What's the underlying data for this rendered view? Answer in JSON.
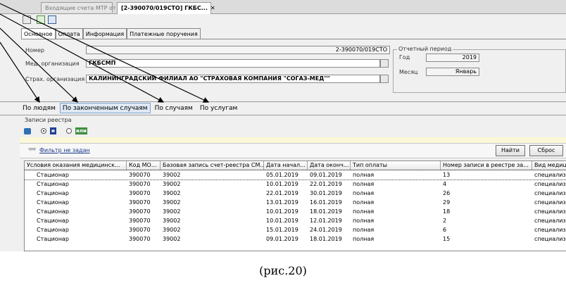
{
  "doc_tabs": {
    "inactive": "Входящие счета МТР от М...",
    "active": "[2-390070/019СТО] ГКБС...",
    "close": "✕"
  },
  "form_tabs": [
    "Основное",
    "Оплата",
    "Информация",
    "Платежные поручения"
  ],
  "form": {
    "number_label": "Номер",
    "number_value": "2-390070/019СТО",
    "medorg_label": "Мед. организация",
    "medorg_value": "ГКБСМП",
    "insorg_label": "Страх. организация",
    "insorg_value": "КАЛИНИНГРАДСКИЙ ФИЛИАЛ АО \"СТРАХОВАЯ КОМПАНИЯ \"СОГАЗ-МЕД\"\""
  },
  "period": {
    "title": "Отчетный период",
    "year_label": "Год",
    "year_value": "2019",
    "month_label": "Месяц",
    "month_value": "Январь"
  },
  "view_tabs": [
    "По людям",
    "По законченным случаям",
    "По случаям",
    "По услугам"
  ],
  "registry": {
    "title": "Записи реестра",
    "and_label": "и",
    "or_label": "или"
  },
  "filter": {
    "text": "Фильтр не задан",
    "find": "Найти",
    "reset": "Сброс"
  },
  "table": {
    "columns": [
      "Условия оказания медицинск...",
      "Код МО...",
      "Базовая запись счет-реестра СМ...",
      "Дата начал...",
      "Дата оконч...",
      "Тип оплаты",
      "Номер записи в реестре за...",
      "Вид медиц..."
    ],
    "rows": [
      [
        "Стационар",
        "390070",
        "39002",
        "05.01.2019",
        "09.01.2019",
        "полная",
        "13",
        "специализ..."
      ],
      [
        "Стационар",
        "390070",
        "39002",
        "10.01.2019",
        "22.01.2019",
        "полная",
        "4",
        "специализ..."
      ],
      [
        "Стационар",
        "390070",
        "39002",
        "22.01.2019",
        "30.01.2019",
        "полная",
        "26",
        "специализ..."
      ],
      [
        "Стационар",
        "390070",
        "39002",
        "13.01.2019",
        "16.01.2019",
        "полная",
        "29",
        "специализ..."
      ],
      [
        "Стационар",
        "390070",
        "39002",
        "10.01.2019",
        "18.01.2019",
        "полная",
        "18",
        "специализ..."
      ],
      [
        "Стационар",
        "390070",
        "39002",
        "10.01.2019",
        "12.01.2019",
        "полная",
        "2",
        "специализ..."
      ],
      [
        "Стационар",
        "390070",
        "39002",
        "15.01.2019",
        "24.01.2019",
        "полная",
        "6",
        "специализ..."
      ],
      [
        "Стационар",
        "390070",
        "39002",
        "09.01.2019",
        "18.01.2019",
        "полная",
        "15",
        "специализ..."
      ]
    ]
  },
  "caption": "(рис.20)",
  "colors": {
    "selected_tab_bg": "#dfe8f4",
    "arrow": "#000000"
  }
}
